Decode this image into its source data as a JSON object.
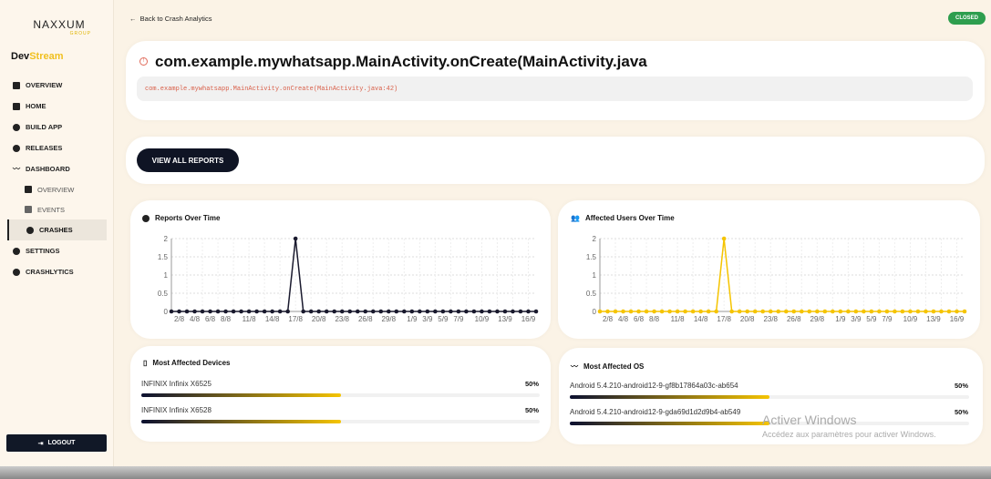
{
  "sidebar": {
    "logo": "NAXXUM",
    "logo_sub": "GROUP",
    "brand_a": "Dev",
    "brand_b": "Stream",
    "items": [
      {
        "label": "OVERVIEW"
      },
      {
        "label": "HOME"
      },
      {
        "label": "BUILD APP"
      },
      {
        "label": "RELEASES"
      },
      {
        "label": "DASHBOARD"
      },
      {
        "label": "OVERVIEW"
      },
      {
        "label": "EVENTS"
      },
      {
        "label": "CRASHES"
      },
      {
        "label": "SETTINGS"
      },
      {
        "label": "CRASHLYTICS"
      }
    ],
    "logout": "LOGOUT"
  },
  "header": {
    "back": "Back to Crash Analytics",
    "status": "CLOSED"
  },
  "crash": {
    "title": "com.example.mywhatsapp.MainActivity.onCreate(MainActivity.java",
    "location": "com.example.mywhatsapp.MainActivity.onCreate(MainActivity.java:42)"
  },
  "view_all": "VIEW ALL REPORTS",
  "chart_data": [
    {
      "type": "line",
      "title": "Reports Over Time",
      "color": "#1a1a2e",
      "ylim": [
        0,
        2
      ],
      "yticks": [
        "0",
        "0.5",
        "1",
        "1.5",
        "2"
      ],
      "xticks": [
        "2/8",
        "4/8",
        "6/8",
        "8/8",
        "11/8",
        "14/8",
        "17/8",
        "20/8",
        "23/8",
        "26/8",
        "29/8",
        "1/9",
        "3/9",
        "5/9",
        "7/9",
        "10/9",
        "13/9",
        "16/9"
      ],
      "xtick_index": [
        1,
        3,
        5,
        7,
        10,
        13,
        16,
        19,
        22,
        25,
        28,
        31,
        33,
        35,
        37,
        40,
        43,
        46
      ],
      "n_points": 48,
      "peak_index": 16,
      "peak_value": 2
    },
    {
      "type": "line",
      "title": "Affected Users Over Time",
      "color": "#f5c400",
      "ylim": [
        0,
        2
      ],
      "yticks": [
        "0",
        "0.5",
        "1",
        "1.5",
        "2"
      ],
      "xticks": [
        "2/8",
        "4/8",
        "6/8",
        "8/8",
        "11/8",
        "14/8",
        "17/8",
        "20/8",
        "23/8",
        "26/8",
        "29/8",
        "1/9",
        "3/9",
        "5/9",
        "7/9",
        "10/9",
        "13/9",
        "16/9"
      ],
      "xtick_index": [
        1,
        3,
        5,
        7,
        10,
        13,
        16,
        19,
        22,
        25,
        28,
        31,
        33,
        35,
        37,
        40,
        43,
        46
      ],
      "n_points": 48,
      "peak_index": 16,
      "peak_value": 2
    }
  ],
  "devices": {
    "title": "Most Affected Devices",
    "items": [
      {
        "name": "INFINIX Infinix X6525",
        "pct": "50%",
        "value": 0.5
      },
      {
        "name": "INFINIX Infinix X6528",
        "pct": "50%",
        "value": 0.5
      }
    ]
  },
  "os": {
    "title": "Most Affected OS",
    "items": [
      {
        "name": "Android 5.4.210-android12-9-gf8b17864a03c-ab654",
        "pct": "50%",
        "value": 0.5
      },
      {
        "name": "Android 5.4.210-android12-9-gda69d1d2d9b4-ab549",
        "pct": "50%",
        "value": 0.5
      }
    ]
  },
  "watermark": {
    "title": "Activer Windows",
    "sub": "Accédez aux paramètres pour activer Windows."
  }
}
